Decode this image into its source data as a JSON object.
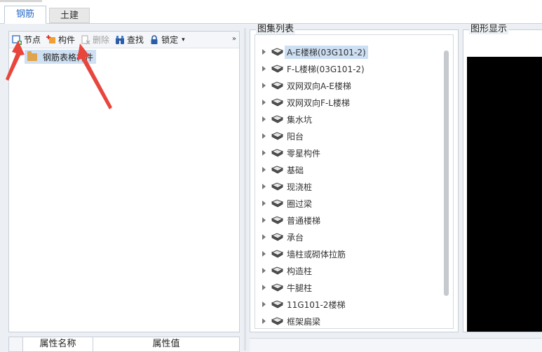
{
  "tabs": [
    {
      "label": "钢筋",
      "active": true
    },
    {
      "label": "土建",
      "active": false
    }
  ],
  "toolbar": {
    "node_label": "节点",
    "component_label": "构件",
    "delete_label": "删除",
    "find_label": "查找",
    "lock_label": "锁定",
    "lock_dropdown": "▾",
    "more": "»"
  },
  "tree": {
    "root_label": "钢筋表格构件"
  },
  "properties": {
    "col_name": "属性名称",
    "col_value": "属性值"
  },
  "atlas": {
    "title": "图集列表",
    "items": [
      {
        "label": "A-E楼梯(03G101-2)",
        "selected": true
      },
      {
        "label": "F-L楼梯(03G101-2)"
      },
      {
        "label": "双网双向A-E楼梯"
      },
      {
        "label": "双网双向F-L楼梯"
      },
      {
        "label": "集水坑"
      },
      {
        "label": "阳台"
      },
      {
        "label": "零星构件"
      },
      {
        "label": "基础"
      },
      {
        "label": "现浇桩"
      },
      {
        "label": "圈过梁"
      },
      {
        "label": "普通楼梯"
      },
      {
        "label": "承台"
      },
      {
        "label": "墙柱或砌体拉筋"
      },
      {
        "label": "构造柱"
      },
      {
        "label": "牛腿柱"
      },
      {
        "label": "11G101-2楼梯"
      },
      {
        "label": "框架扁梁"
      }
    ]
  },
  "graphic": {
    "title": "图形显示"
  },
  "colors": {
    "accent": "#2b6cc4",
    "selection": "#cddff3",
    "annotation_arrow": "#e8453c"
  }
}
